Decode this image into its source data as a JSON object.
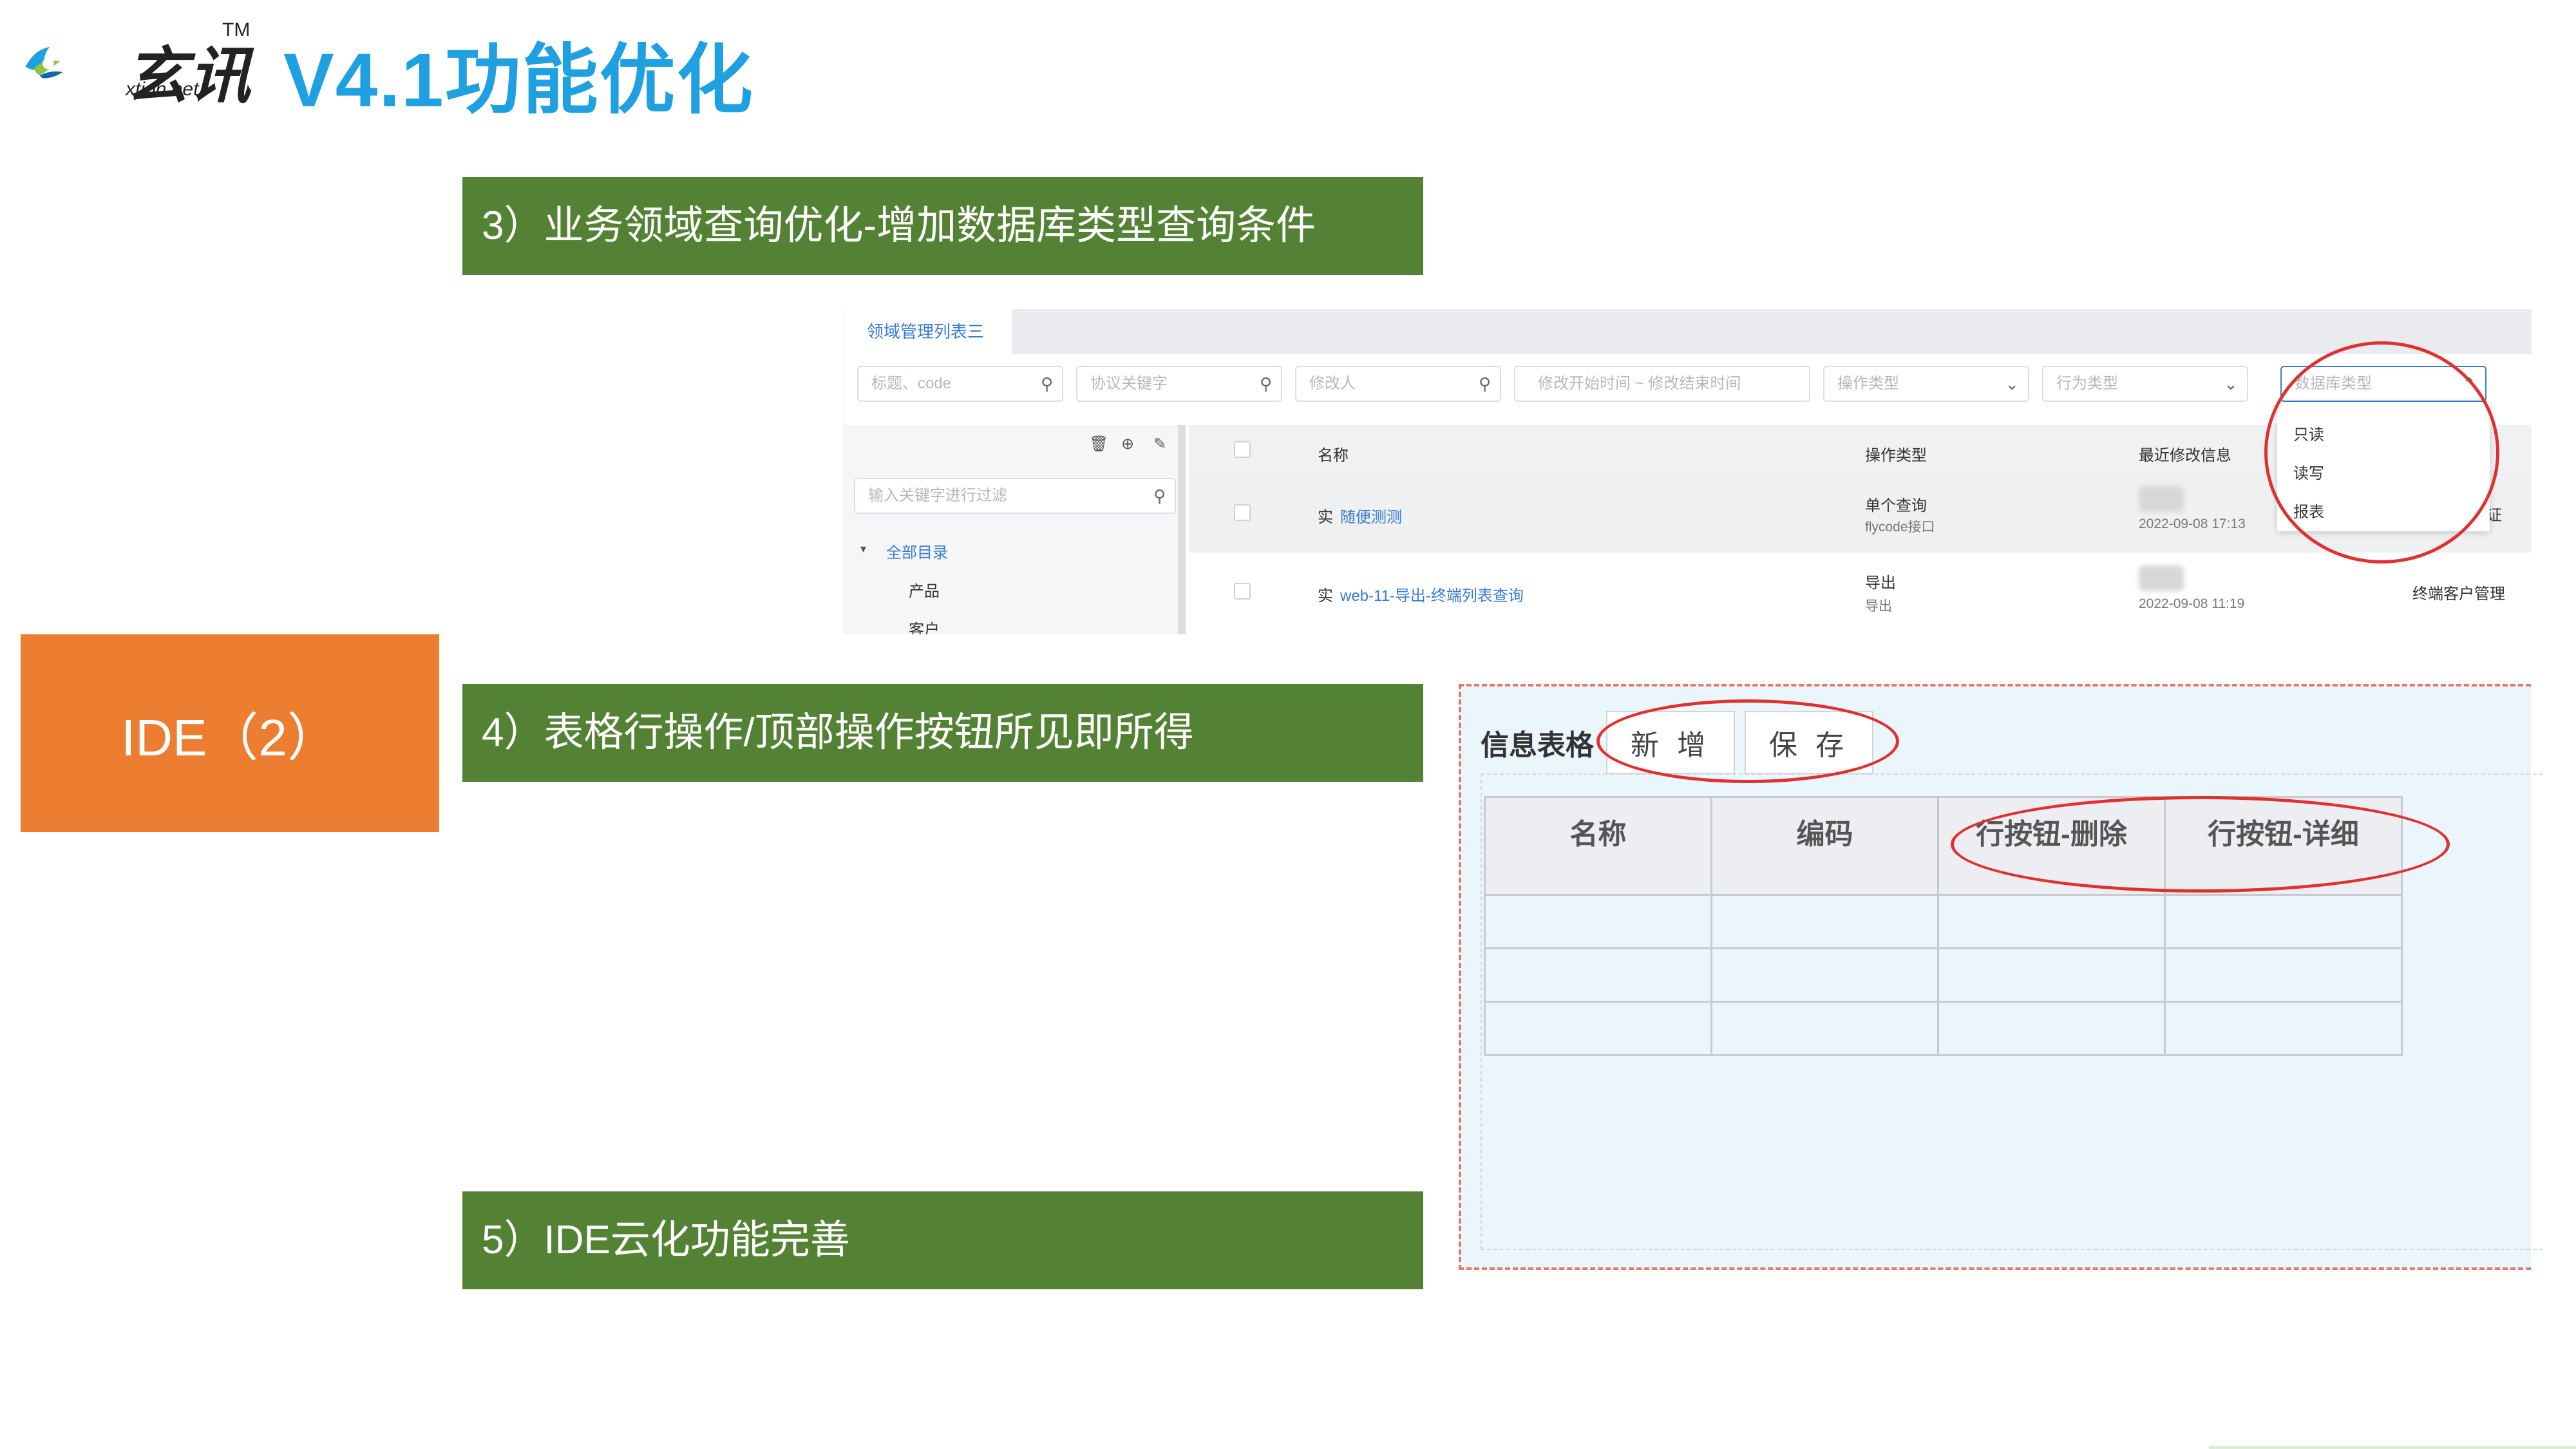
{
  "header": {
    "logo_text": "玄讯",
    "logo_tm": "TM",
    "logo_sub": "xtion.net",
    "title": "V4.1功能优化"
  },
  "side_label": "IDE（2）",
  "banners": [
    "3）业务领域查询优化-增加数据库类型查询条件",
    "4）表格行操作/顶部操作按钮所见即所得",
    "5）IDE云化功能完善"
  ],
  "screenshot1": {
    "tab": "领域管理列表三",
    "filters": [
      {
        "placeholder": "标题、code",
        "icon": "search-icon"
      },
      {
        "placeholder": "协议关键字",
        "icon": "search-icon"
      },
      {
        "placeholder": "修改人",
        "icon": "search-icon"
      },
      {
        "placeholder": "修改开始时间  ~  修改结束时间",
        "icon": ""
      },
      {
        "placeholder": "操作类型",
        "icon": "chevron-down-icon"
      },
      {
        "placeholder": "行为类型",
        "icon": "chevron-down-icon"
      },
      {
        "placeholder": "数据库类型",
        "icon": "chevron-up-icon"
      }
    ],
    "sidebar": {
      "search_placeholder": "输入关键字进行过滤",
      "tree_root": "全部目录",
      "tree_items": [
        "产品",
        "客户"
      ]
    },
    "columns": [
      "名称",
      "操作类型",
      "最近修改信息"
    ],
    "rows": [
      {
        "prefix": "实",
        "name": "随便测测",
        "op_type": "单个查询",
        "op_sub": "flycode接口",
        "time": "2022-09-08 17:13",
        "extra": "证"
      },
      {
        "prefix": "实",
        "name": "web-11-导出-终端列表查询",
        "op_type": "导出",
        "op_sub": "导出",
        "time": "2022-09-08 11:19",
        "extra": "终端客户管理"
      }
    ],
    "dropdown_options": [
      "只读",
      "读写",
      "报表"
    ]
  },
  "screenshot2": {
    "label": "信息表格",
    "buttons": [
      "新 增",
      "保 存"
    ],
    "columns": [
      "名称",
      "编码",
      "行按钮-删除",
      "行按钮-详细"
    ],
    "empty_rows": 3
  }
}
